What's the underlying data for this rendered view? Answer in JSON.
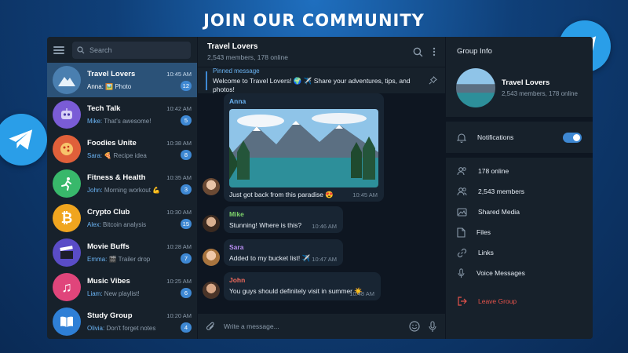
{
  "banner": "JOIN OUR COMMUNITY",
  "search": {
    "placeholder": "Search"
  },
  "chats": [
    {
      "name": "Travel Lovers",
      "time": "10:45 AM",
      "who": "Anna:",
      "preview": "🖼️ Photo",
      "count": "12",
      "color": "#4a7fb0",
      "icon": "mountain-icon"
    },
    {
      "name": "Tech Talk",
      "time": "10:42 AM",
      "who": "Mike:",
      "preview": "That's awesome!",
      "count": "5",
      "color": "#7a5cd6",
      "icon": "robot-icon"
    },
    {
      "name": "Foodies Unite",
      "time": "10:38 AM",
      "who": "Sara:",
      "preview": "🍕 Recipe idea",
      "count": "8",
      "color": "#e0603a",
      "icon": "pizza-icon"
    },
    {
      "name": "Fitness & Health",
      "time": "10:35 AM",
      "who": "John:",
      "preview": "Morning workout 💪",
      "count": "3",
      "color": "#38b86b",
      "icon": "runner-icon"
    },
    {
      "name": "Crypto Club",
      "time": "10:30 AM",
      "who": "Alex:",
      "preview": "Bitcoin analysis",
      "count": "15",
      "color": "#f0a51f",
      "icon": "bitcoin-icon"
    },
    {
      "name": "Movie Buffs",
      "time": "10:28 AM",
      "who": "Emma:",
      "preview": "🎬 Trailer drop",
      "count": "7",
      "color": "#5a4cc7",
      "icon": "clapper-icon"
    },
    {
      "name": "Music Vibes",
      "time": "10:25 AM",
      "who": "Liam:",
      "preview": "New playlist!",
      "count": "6",
      "color": "#e0457b",
      "icon": "music-icon"
    },
    {
      "name": "Study Group",
      "time": "10:20 AM",
      "who": "Olivia:",
      "preview": "Don't forget notes",
      "count": "4",
      "color": "#2e7fd6",
      "icon": "book-icon"
    }
  ],
  "header": {
    "title": "Travel Lovers",
    "subtitle": "2,543 members, 178 online"
  },
  "pinned": {
    "label": "Pinned message",
    "text": "Welcome to Travel Lovers! 🌍 ✈️ Share your adventures, tips, and photos!"
  },
  "messages": [
    {
      "sender": "Anna",
      "text": "Just got back from this paradise 😍",
      "time": "10:45 AM",
      "color": "#6ab3f3"
    },
    {
      "sender": "Mike",
      "text": "Stunning! Where is this?",
      "time": "10:46 AM",
      "color": "#7ed36b"
    },
    {
      "sender": "Sara",
      "text": "Added to my bucket list! ✈️",
      "time": "10:47 AM",
      "color": "#b58cf0"
    },
    {
      "sender": "John",
      "text": "You guys should definitely visit in summer ☀️",
      "time": "10:48 AM",
      "color": "#f06a5c"
    }
  ],
  "composer": {
    "placeholder": "Write a message..."
  },
  "info": {
    "title": "Group Info",
    "name": "Travel Lovers",
    "subtitle": "2,543 members, 178 online",
    "notifications": "Notifications",
    "notifications_on": true,
    "rows": [
      "178 online",
      "2,543 members",
      "Shared Media",
      "Files",
      "Links",
      "Voice Messages"
    ],
    "leave": "Leave Group"
  }
}
